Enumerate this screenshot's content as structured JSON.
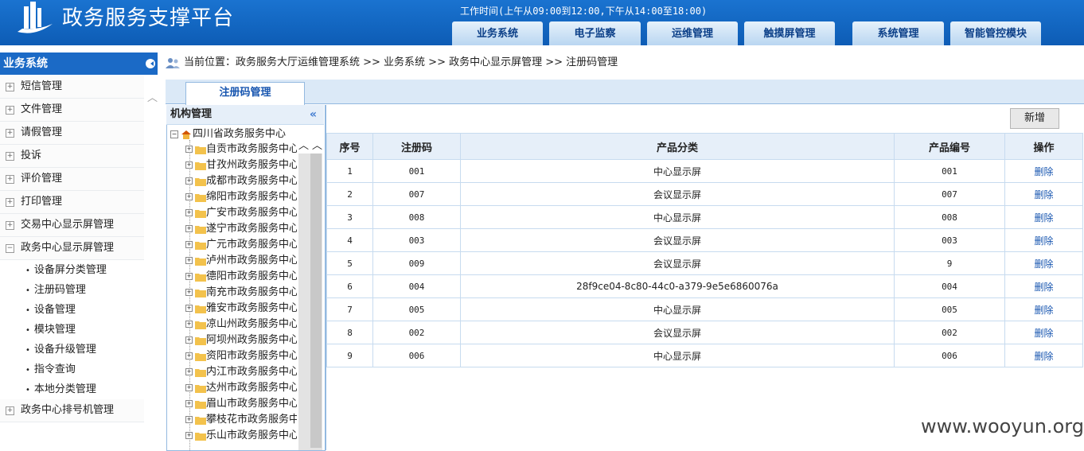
{
  "header": {
    "app_title": "政务服务支撑平台",
    "work_time": "工作时间(上午从09:00到12:00,下午从14:00至18:00)",
    "nav": [
      "业务系统",
      "电子监察",
      "运维管理",
      "触摸屏管理",
      "系统管理",
      "智能管控模块"
    ]
  },
  "sidebar": {
    "title": "业务系统",
    "items": [
      "短信管理",
      "文件管理",
      "请假管理",
      "投诉",
      "评价管理",
      "打印管理",
      "交易中心显示屏管理",
      "政务中心显示屏管理"
    ],
    "sub_items": [
      "设备屏分类管理",
      "注册码管理",
      "设备管理",
      "模块管理",
      "设备升级管理",
      "指令查询",
      "本地分类管理"
    ],
    "last_item": "政务中心排号机管理",
    "expanded_marker": "−",
    "collapsed_marker": "+"
  },
  "breadcrumb": "当前位置：政务服务大厅运维管理系统 >> 业务系统 >> 政务中心显示屏管理 >> 注册码管理",
  "tab": "注册码管理",
  "org": {
    "title": "机构管理",
    "collapse_glyph": "«",
    "root": "四川省政务服务中心",
    "children": [
      "自贡市政务服务中心",
      "甘孜州政务服务中心",
      "成都市政务服务中心",
      "绵阳市政务服务中心",
      "广安市政务服务中心",
      "遂宁市政务服务中心",
      "广元市政务服务中心",
      "泸州市政务服务中心",
      "德阳市政务服务中心",
      "南充市政务服务中心",
      "雅安市政务服务中心",
      "凉山州政务服务中心",
      "阿坝州政务服务中心",
      "资阳市政务服务中心",
      "内江市政务服务中心",
      "达州市政务服务中心",
      "眉山市政务服务中心",
      "攀枝花市政务服务中心",
      "乐山市政务服务中心"
    ]
  },
  "toolbar": {
    "add_label": "新增"
  },
  "table": {
    "headers": [
      "序号",
      "注册码",
      "产品分类",
      "产品编号",
      "操作"
    ],
    "rows": [
      [
        "1",
        "001",
        "中心显示屏",
        "001",
        "删除"
      ],
      [
        "2",
        "007",
        "会议显示屏",
        "007",
        "删除"
      ],
      [
        "3",
        "008",
        "中心显示屏",
        "008",
        "删除"
      ],
      [
        "4",
        "003",
        "会议显示屏",
        "003",
        "删除"
      ],
      [
        "5",
        "009",
        "会议显示屏",
        "9",
        "删除"
      ],
      [
        "6",
        "004",
        "28f9ce04-8c80-44c0-a379-9e5e6860076a",
        "004",
        "删除"
      ],
      [
        "7",
        "005",
        "中心显示屏",
        "005",
        "删除"
      ],
      [
        "8",
        "002",
        "会议显示屏",
        "002",
        "删除"
      ],
      [
        "9",
        "006",
        "中心显示屏",
        "006",
        "删除"
      ]
    ]
  },
  "watermark": "www.wooyun.org"
}
